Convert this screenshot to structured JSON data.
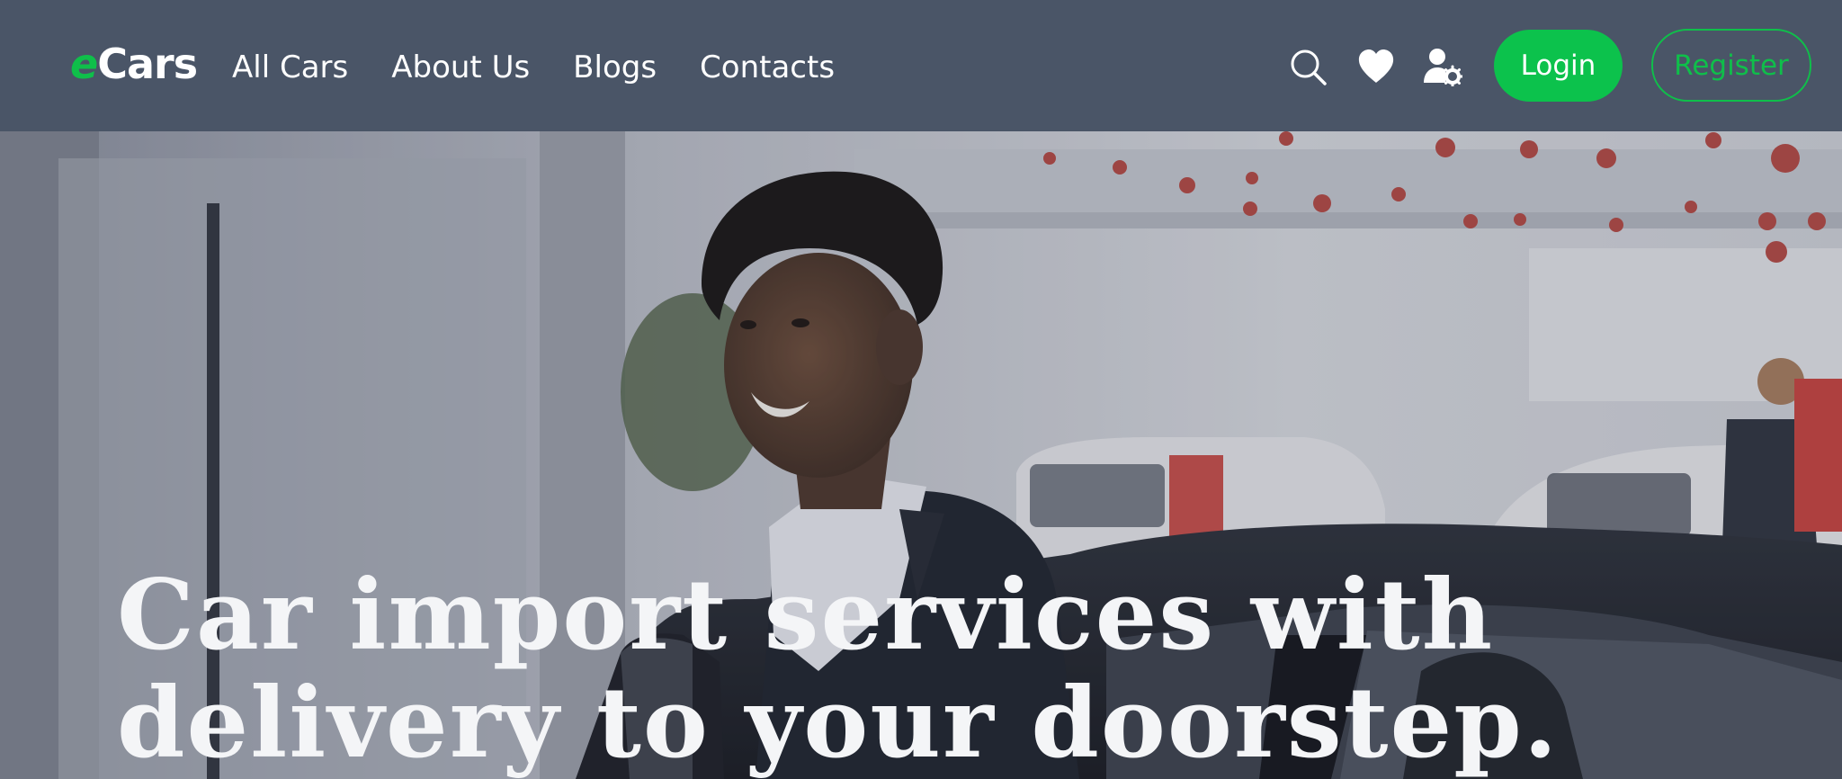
{
  "brand": {
    "logo_first": "e",
    "logo_rest": "Cars",
    "accent_color": "#0fbf4a"
  },
  "nav": {
    "links": [
      "All Cars",
      "About Us",
      "Blogs",
      "Contacts"
    ]
  },
  "header_icons": [
    "search-icon",
    "heart-icon",
    "user-settings-icon"
  ],
  "buttons": {
    "login": "Login",
    "register": "Register"
  },
  "hero": {
    "title_line1": "Car import services with",
    "title_line2": "delivery to your doorstep."
  },
  "colors": {
    "navbar_bg": "#4a5567",
    "login_bg": "#0cc24c",
    "register_border": "#0fbf4a",
    "hero_text": "#f4f5f7"
  }
}
